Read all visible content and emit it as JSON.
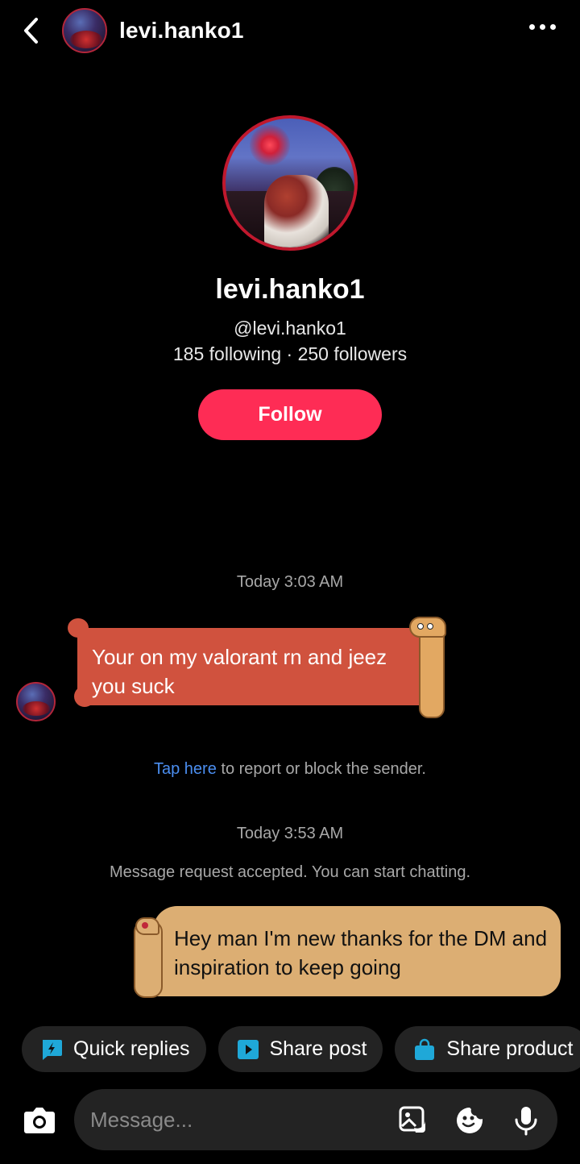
{
  "header": {
    "username": "levi.hanko1"
  },
  "profile": {
    "name": "levi.hanko1",
    "handle": "@levi.hanko1",
    "stats": "185 following · 250 followers",
    "follow_label": "Follow"
  },
  "chat": {
    "timestamp_1": "Today 3:03 AM",
    "incoming_message": "Your on my valorant rn and jeez you suck",
    "report_link": "Tap here",
    "report_rest": " to report or block the sender.",
    "timestamp_2": "Today 3:53 AM",
    "accepted_notice": "Message request accepted. You can start chatting.",
    "outgoing_message": "Hey man I'm new thanks for the DM and inspiration to keep going"
  },
  "quick_actions": [
    {
      "label": "Quick replies",
      "icon": "lightning-bubble-icon"
    },
    {
      "label": "Share post",
      "icon": "play-square-icon"
    },
    {
      "label": "Share product",
      "icon": "shopping-bag-icon"
    }
  ],
  "composer": {
    "placeholder": "Message..."
  },
  "colors": {
    "accent": "#fe2c55",
    "incoming_bubble": "#d0523e",
    "outgoing_bubble": "#dcae73",
    "link": "#4b8ef0",
    "chip_icon": "#1fa8d8"
  }
}
